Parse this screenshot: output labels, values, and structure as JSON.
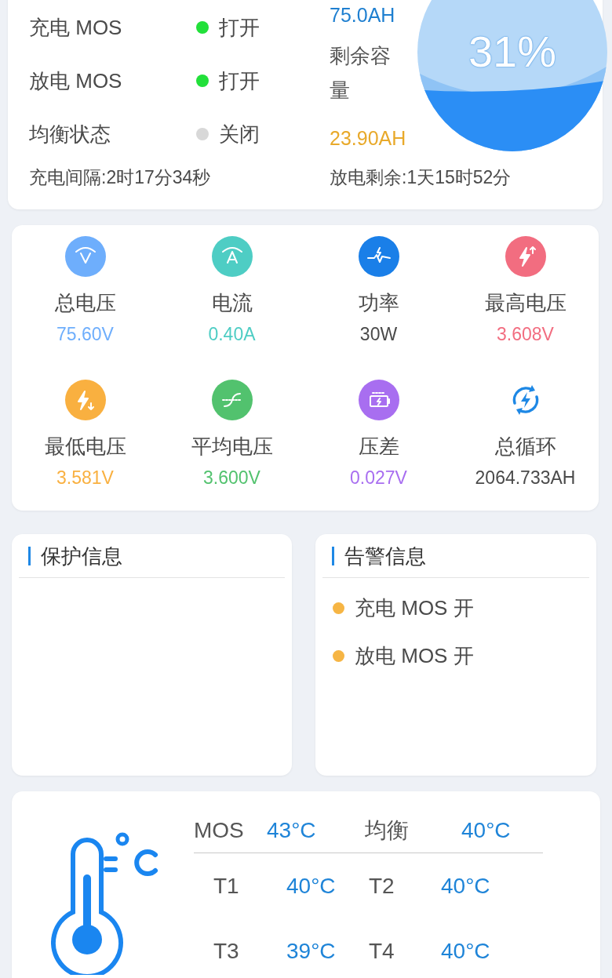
{
  "status": {
    "rows": [
      {
        "label": "充电 MOS",
        "on": true,
        "state": "打开"
      },
      {
        "label": "放电 MOS",
        "on": true,
        "state": "打开"
      },
      {
        "label": "均衡状态",
        "on": false,
        "state": "关闭"
      }
    ],
    "capacity_total": "75.0AH",
    "capacity_label": "剩余容量",
    "capacity_remaining": "23.90AH",
    "gauge": {
      "level": 0.31,
      "reading": "31%"
    },
    "charge_interval": "充电间隔:2时17分34秒",
    "discharge_remaining": "放电剩余:1天15时52分"
  },
  "metrics": [
    {
      "kind": "voltage",
      "label": "总电压",
      "value": "75.60V",
      "color": "#6eaefc"
    },
    {
      "kind": "current",
      "label": "电流",
      "value": "0.40A",
      "color": "#4ecdc4"
    },
    {
      "kind": "power",
      "label": "功率",
      "value": "30W",
      "color": "#1a7fe8"
    },
    {
      "kind": "max",
      "label": "最高电压",
      "value": "3.608V",
      "color": "#f26d80"
    },
    {
      "kind": "min",
      "label": "最低电压",
      "value": "3.581V",
      "color": "#f9b040"
    },
    {
      "kind": "average",
      "label": "平均电压",
      "value": "3.600V",
      "color": "#52c26e"
    },
    {
      "kind": "delta",
      "label": "压差",
      "value": "0.027V",
      "color": "#a86ef0"
    },
    {
      "kind": "cycle",
      "label": "总循环",
      "value": "2064.733AH",
      "color": "#1e88e5"
    }
  ],
  "protection": {
    "title": "保护信息"
  },
  "alarms": {
    "title": "告警信息",
    "items": [
      "充电 MOS 开",
      "放电 MOS 开"
    ]
  },
  "temperatures": {
    "main": [
      {
        "label": "MOS",
        "value": "43°C"
      },
      {
        "label": "均衡",
        "value": "40°C"
      }
    ],
    "sensors": [
      {
        "label": "T1",
        "value": "40°C"
      },
      {
        "label": "T2",
        "value": "40°C"
      },
      {
        "label": "T3",
        "value": "39°C"
      },
      {
        "label": "T4",
        "value": "40°C"
      }
    ]
  }
}
